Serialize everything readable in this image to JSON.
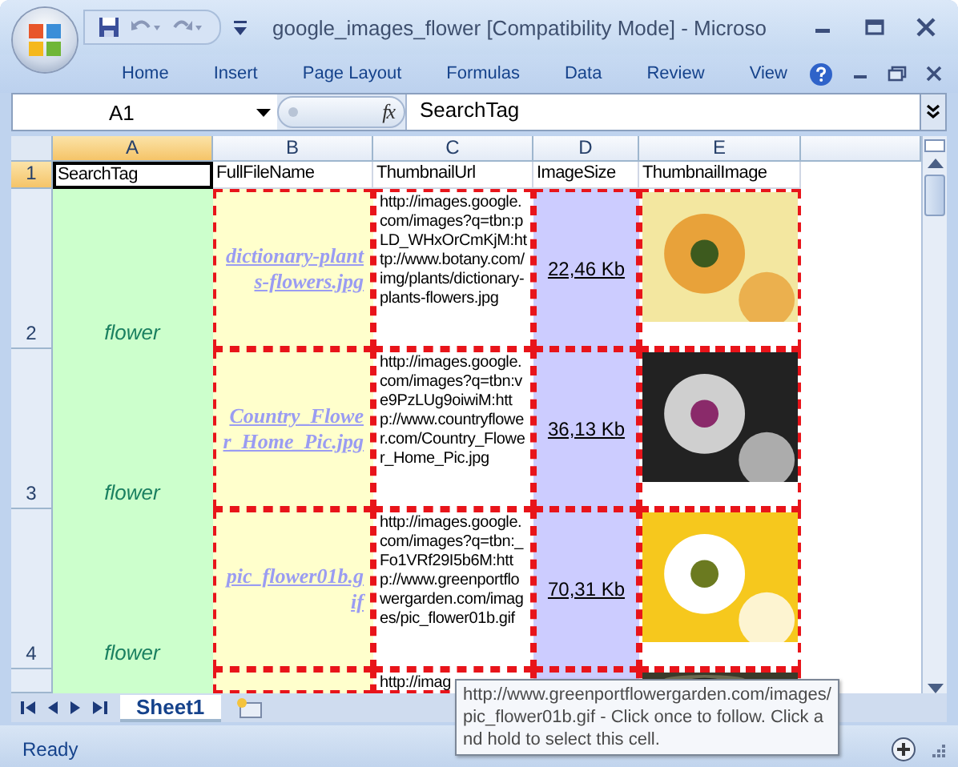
{
  "window": {
    "title": "google_images_flower  [Compatibility Mode] - Microso"
  },
  "ribbon_tabs": [
    {
      "label": "Home"
    },
    {
      "label": "Insert"
    },
    {
      "label": "Page Layout"
    },
    {
      "label": "Formulas"
    },
    {
      "label": "Data"
    },
    {
      "label": "Review"
    },
    {
      "label": "View"
    }
  ],
  "name_box": {
    "value": "A1"
  },
  "formula_bar": {
    "function_label": "fx",
    "value": "SearchTag"
  },
  "columns": [
    {
      "label": "A",
      "selected": true
    },
    {
      "label": "B",
      "selected": false
    },
    {
      "label": "C",
      "selected": false
    },
    {
      "label": "D",
      "selected": false
    },
    {
      "label": "E",
      "selected": false
    }
  ],
  "rows": [
    {
      "number": "1",
      "selected": true,
      "cells": [
        {
          "kind": "header",
          "text": "SearchTag",
          "selected": true
        },
        {
          "kind": "header",
          "text": "FullFileName"
        },
        {
          "kind": "header",
          "text": "ThumbnailUrl"
        },
        {
          "kind": "header",
          "text": "ImageSize"
        },
        {
          "kind": "header",
          "text": "ThumbnailImage"
        }
      ]
    },
    {
      "number": "2",
      "selected": false,
      "cells": [
        {
          "kind": "tag",
          "text": "flower"
        },
        {
          "kind": "link",
          "text": "dictionary-plants-flowers.jpg"
        },
        {
          "kind": "url",
          "text": "http://images.google.com/images?q=tbn:pLD_WHxOrCmKjM:http://www.botany.com/img/plants/dictionary-plants-flowers.jpg"
        },
        {
          "kind": "size",
          "text": "22,46 Kb"
        },
        {
          "kind": "image"
        }
      ]
    },
    {
      "number": "3",
      "selected": false,
      "cells": [
        {
          "kind": "tag",
          "text": "flower"
        },
        {
          "kind": "link",
          "text": "Country_Flower_Home_Pic.jpg"
        },
        {
          "kind": "url",
          "text": "http://images.google.com/images?q=tbn:ve9PzLUg9oiwiM:http://www.countryflower.com/Country_Flower_Home_Pic.jpg"
        },
        {
          "kind": "size",
          "text": "36,13 Kb"
        },
        {
          "kind": "image"
        }
      ]
    },
    {
      "number": "4",
      "selected": false,
      "cells": [
        {
          "kind": "tag",
          "text": "flower"
        },
        {
          "kind": "link",
          "text": "pic_flower01b.gif"
        },
        {
          "kind": "url",
          "text": "http://images.google.com/images?q=tbn:_Fo1VRf29I5b6M:http://www.greenportflowergarden.com/images/pic_flower01b.gif"
        },
        {
          "kind": "size",
          "text": "70,31 Kb"
        },
        {
          "kind": "image"
        }
      ]
    },
    {
      "selected": false,
      "cells": [
        {
          "kind": "tag"
        },
        {
          "kind": "link"
        },
        {
          "kind": "url",
          "text": "http://imag"
        },
        {
          "kind": "size"
        },
        {
          "kind": "image"
        }
      ]
    }
  ],
  "sheet_tabs": [
    {
      "label": "Sheet1",
      "selected": true
    }
  ],
  "tooltip": {
    "text": "http://www.greenportflowergarden.com/images/pic_flower01b.gif - Click once to follow. Click and hold to select this cell."
  },
  "status_bar": {
    "text": "Ready"
  }
}
